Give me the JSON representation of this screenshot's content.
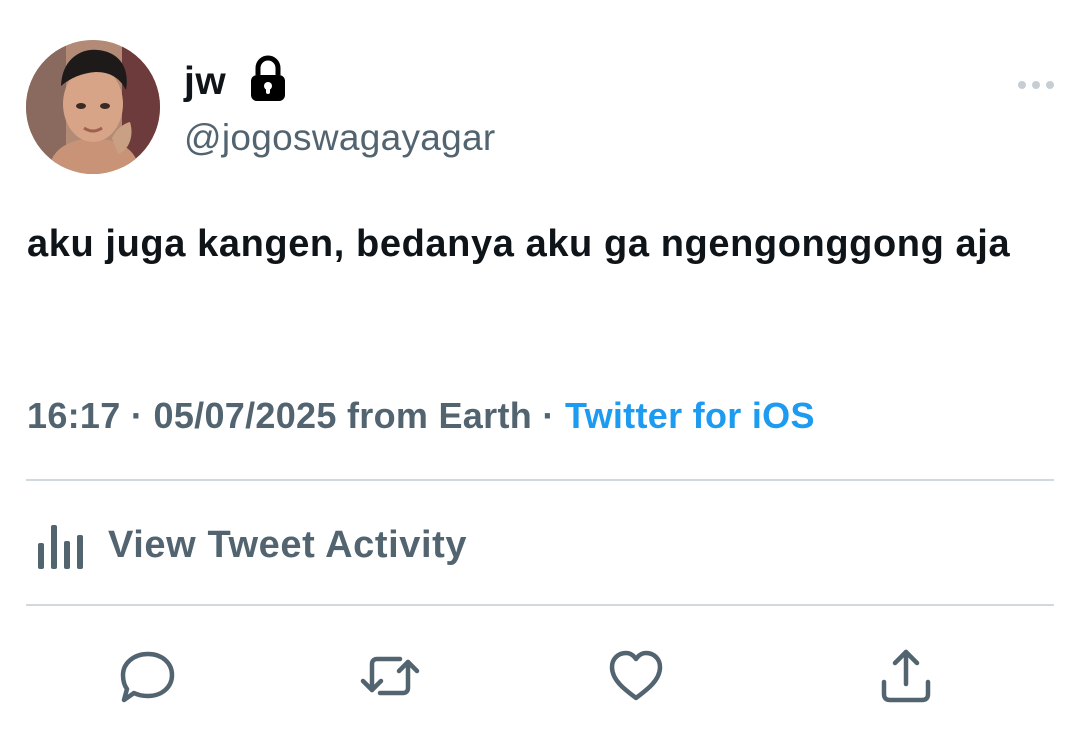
{
  "user": {
    "display_name": "jw",
    "username": "@jogoswagayagar",
    "protected_icon": "lock-icon",
    "avatar_icon": "profile-photo"
  },
  "tweet": {
    "text": "aku juga kangen, bedanya aku ga ngengonggong aja",
    "time": "16:17",
    "date": "05/07/2025",
    "location": "from Earth",
    "separator": "·",
    "source": "Twitter for iOS"
  },
  "activity": {
    "label": "View Tweet Activity",
    "icon": "bar-chart-icon"
  },
  "actions": {
    "reply_icon": "reply-icon",
    "retweet_icon": "retweet-icon",
    "like_icon": "heart-icon",
    "share_icon": "share-icon"
  },
  "colors": {
    "text": "#0f1419",
    "secondary": "#536471",
    "link": "#1d9bf0",
    "divider": "#cfd9de"
  }
}
